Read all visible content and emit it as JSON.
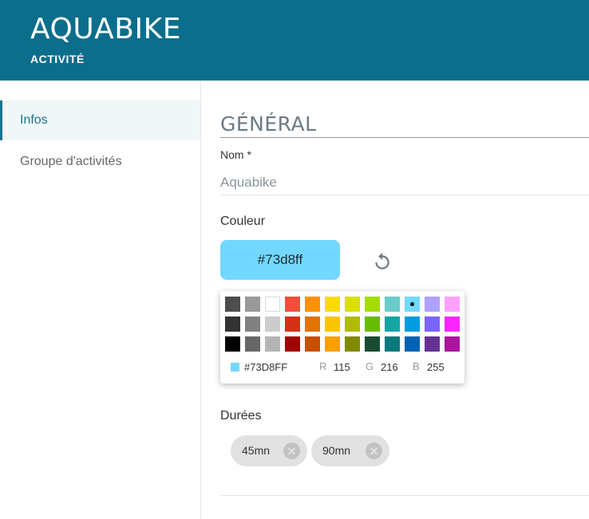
{
  "header": {
    "title": "AQUABIKE",
    "subtitle": "ACTIVITÉ"
  },
  "sidebar": {
    "items": [
      {
        "label": "Infos",
        "active": true
      },
      {
        "label": "Groupe d'activités",
        "active": false
      }
    ]
  },
  "section": {
    "title": "GÉNÉRAL"
  },
  "name_field": {
    "label": "Nom *",
    "value": "Aquabike"
  },
  "color_field": {
    "label": "Couleur",
    "value": "#73d8ff",
    "reset_icon": "refresh-icon"
  },
  "picker": {
    "swatches": [
      [
        "#4d4d4d",
        "#999999",
        "#ffffff",
        "#f44e3b",
        "#fe9200",
        "#fcdc00",
        "#dbdf00",
        "#a4dd00",
        "#68ccca",
        "#73d8ff",
        "#aea1ff",
        "#fda1ff"
      ],
      [
        "#333333",
        "#808080",
        "#cccccc",
        "#d33115",
        "#e27300",
        "#fcc400",
        "#b0bc00",
        "#68bc00",
        "#16a5a5",
        "#009ce0",
        "#7b64ff",
        "#fa28ff"
      ],
      [
        "#000000",
        "#666666",
        "#b3b3b3",
        "#9f0500",
        "#c45100",
        "#fb9e00",
        "#808900",
        "#194d33",
        "#0c797d",
        "#0062b1",
        "#653294",
        "#ab149e"
      ]
    ],
    "selected": "#73d8ff",
    "hex": "#73D8FF",
    "r_label": "R",
    "r": "115",
    "g_label": "G",
    "g": "216",
    "b_label": "B",
    "b": "255"
  },
  "durations": {
    "label": "Durées",
    "chips": [
      {
        "label": "45mn"
      },
      {
        "label": "90mn"
      }
    ]
  }
}
